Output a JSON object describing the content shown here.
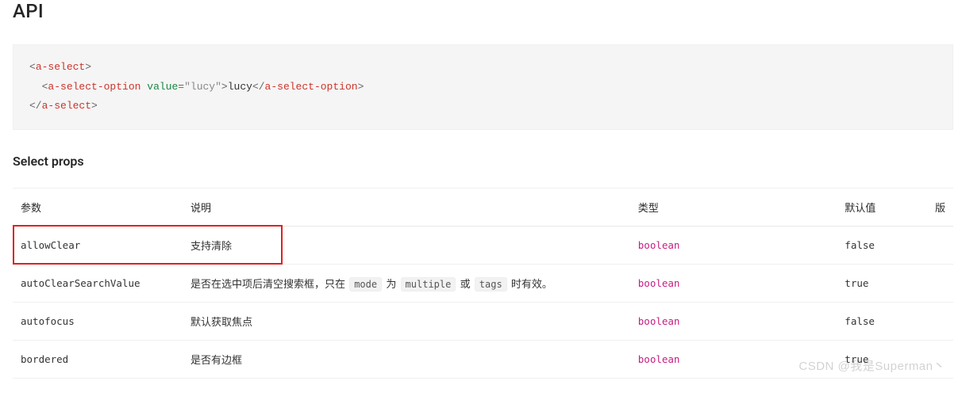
{
  "heading": "API",
  "code_example": {
    "line1": {
      "open_tag": "a-select"
    },
    "line2": {
      "open_tag": "a-select-option",
      "attr": "value",
      "attr_val": "\"lucy\"",
      "text": "lucy",
      "close_tag": "a-select-option"
    },
    "line3": {
      "close_tag": "a-select"
    }
  },
  "section_title": "Select props",
  "columns": {
    "param": "参数",
    "desc": "说明",
    "type": "类型",
    "default": "默认值",
    "version": "版"
  },
  "rows": [
    {
      "param": "allowClear",
      "desc_plain": "支持清除",
      "desc_codes": [],
      "type": "boolean",
      "default": "false"
    },
    {
      "param": "autoClearSearchValue",
      "desc_parts": {
        "p1": "是否在选中项后清空搜索框，只在 ",
        "c1": "mode",
        "p2": " 为 ",
        "c2": "multiple",
        "p3": " 或 ",
        "c3": "tags",
        "p4": " 时有效。"
      },
      "type": "boolean",
      "default": "true"
    },
    {
      "param": "autofocus",
      "desc_plain": "默认获取焦点",
      "type": "boolean",
      "default": "false"
    },
    {
      "param": "bordered",
      "desc_plain": "是否有边框",
      "type": "boolean",
      "default": "true"
    }
  ],
  "watermark": "CSDN @我是Superman丶",
  "highlight_row_index": 0
}
